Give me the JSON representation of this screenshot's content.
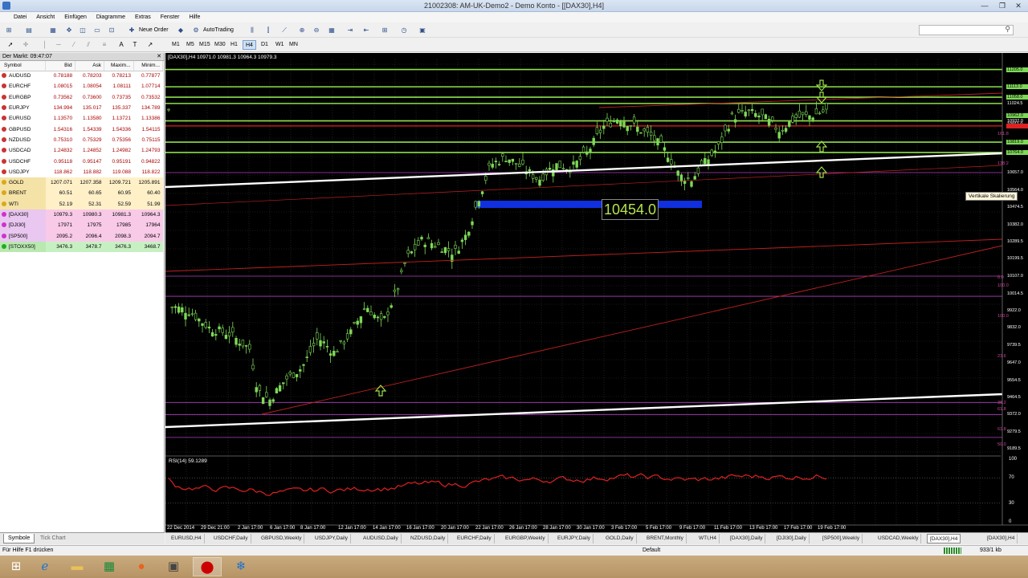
{
  "window": {
    "title": "21002308: AM-UK-Demo2 - Demo Konto - [[DAX30],H4]",
    "minimize": "—",
    "maximize": "❐",
    "close": "✕"
  },
  "menu": [
    "Datei",
    "Ansicht",
    "Einfügen",
    "Diagramme",
    "Extras",
    "Fenster",
    "Hilfe"
  ],
  "toolbar": {
    "new_order": "Neue Order",
    "autotrading": "AutoTrading",
    "timeframes": [
      "M1",
      "M5",
      "M15",
      "M30",
      "H1",
      "H4",
      "D1",
      "W1",
      "MN"
    ]
  },
  "market_watch": {
    "header": "Der Markt: 09:47:07",
    "columns": [
      "Symbol",
      "Bid",
      "Ask",
      "Maxim...",
      "Minim..."
    ],
    "rows": [
      {
        "symbol": "AUDUSD",
        "bid": "0.78188",
        "ask": "0.78203",
        "max": "0.78213",
        "min": "0.77877",
        "style": "fx"
      },
      {
        "symbol": "EURCHF",
        "bid": "1.08015",
        "ask": "1.08054",
        "max": "1.08111",
        "min": "1.07714",
        "style": "fx"
      },
      {
        "symbol": "EURGBP",
        "bid": "0.73562",
        "ask": "0.73600",
        "max": "0.73735",
        "min": "0.73532",
        "style": "fx"
      },
      {
        "symbol": "EURJPY",
        "bid": "134.994",
        "ask": "135.017",
        "max": "135.337",
        "min": "134.789",
        "style": "fx"
      },
      {
        "symbol": "EURUSD",
        "bid": "1.13570",
        "ask": "1.13580",
        "max": "1.13721",
        "min": "1.13386",
        "style": "fx"
      },
      {
        "symbol": "GBPUSD",
        "bid": "1.54316",
        "ask": "1.54339",
        "max": "1.54336",
        "min": "1.54115",
        "style": "fx"
      },
      {
        "symbol": "NZDUSD",
        "bid": "0.75310",
        "ask": "0.75329",
        "max": "0.75356",
        "min": "0.75115",
        "style": "fx"
      },
      {
        "symbol": "USDCAD",
        "bid": "1.24832",
        "ask": "1.24852",
        "max": "1.24982",
        "min": "1.24793",
        "style": "fx"
      },
      {
        "symbol": "USDCHF",
        "bid": "0.95118",
        "ask": "0.95147",
        "max": "0.95191",
        "min": "0.94822",
        "style": "fx"
      },
      {
        "symbol": "USDJPY",
        "bid": "118.862",
        "ask": "118.882",
        "max": "119.088",
        "min": "118.822",
        "style": "fx"
      },
      {
        "symbol": "GOLD",
        "bid": "1207.071",
        "ask": "1207.358",
        "max": "1209.721",
        "min": "1205.891",
        "style": "gold"
      },
      {
        "symbol": "BRENT",
        "bid": "60.51",
        "ask": "60.65",
        "max": "60.95",
        "min": "60.40",
        "style": "gold"
      },
      {
        "symbol": "WTI",
        "bid": "52.19",
        "ask": "52.31",
        "max": "52.59",
        "min": "51.99",
        "style": "gold"
      },
      {
        "symbol": "[DAX30]",
        "bid": "10979.3",
        "ask": "10980.3",
        "max": "10981.3",
        "min": "10964.3",
        "style": "pink"
      },
      {
        "symbol": "[DJI30]",
        "bid": "17971",
        "ask": "17975",
        "max": "17985",
        "min": "17964",
        "style": "pink"
      },
      {
        "symbol": "[SP500]",
        "bid": "2095.2",
        "ask": "2096.4",
        "max": "2098.3",
        "min": "2094.7",
        "style": "pink"
      },
      {
        "symbol": "[STOXX50]",
        "bid": "3476.3",
        "ask": "3478.7",
        "max": "3476.3",
        "min": "3468.7",
        "style": "green"
      }
    ],
    "tabs": [
      "Symbole",
      "Tick Chart"
    ]
  },
  "chart": {
    "title": "[DAX30],H4  10971.0 10981.3 10964.3 10979.3",
    "big_price": "10454.0",
    "tooltip": "Vertikale Skalierung",
    "rsi_title": "RSI(14) 59.1289",
    "price_axis": [
      "11205.0",
      "11113.0",
      "11058.0",
      "11024.5",
      "10962.0",
      "10932.0",
      "10911.0",
      "10819.0",
      "10764.0",
      "10657.0",
      "10564.0",
      "10474.5",
      "10382.0",
      "10289.5",
      "10199.5",
      "10107.0",
      "10014.5",
      "9922.0",
      "9832.0",
      "9739.5",
      "9647.0",
      "9554.5",
      "9464.5",
      "9372.0",
      "9279.5",
      "9189.5"
    ],
    "right_labels": [
      "161.8",
      "138.2",
      "0.0",
      "100.0",
      "100.0",
      "23.6",
      "38.2",
      "61.8",
      "61.8",
      "50.0"
    ],
    "rsi_axis": [
      "100",
      "70",
      "30",
      "0"
    ],
    "time_axis": [
      "22 Dec 2014",
      "29 Dec 21:00",
      "2 Jan 17:00",
      "6 Jan 17:00",
      "8 Jan 17:00",
      "12 Jan 17:00",
      "14 Jan 17:00",
      "16 Jan 17:00",
      "20 Jan 17:00",
      "22 Jan 17:00",
      "26 Jan 17:00",
      "28 Jan 17:00",
      "30 Jan 17:00",
      "3 Feb 17:00",
      "5 Feb 17:00",
      "9 Feb 17:00",
      "11 Feb 17:00",
      "13 Feb 17:00",
      "17 Feb 17:00",
      "19 Feb 17:00"
    ]
  },
  "chart_tabs": [
    "EURUSD,H4",
    "USDCHF,Daily",
    "GBPUSD,Weekly",
    "USDJPY,Daily",
    "AUDUSD,Daily",
    "NZDUSD,Daily",
    "EURCHF,Daily",
    "EURGBP,Weekly",
    "EURJPY,Daily",
    "GOLD,Daily",
    "BRENT,Monthly",
    "WTI,H4",
    "[DAX30],Daily",
    "[DJI30],Daily",
    "[SP500],Weekly",
    "USDCAD,Weekly",
    "[DAX30],H4",
    "[DAX30],H4"
  ],
  "status": {
    "help": "Für Hilfe F1 drücken",
    "profile": "Default",
    "traffic": "933/1 kb"
  },
  "colors": {
    "chart_bg": "#000000",
    "candle": "#7ed957",
    "level_green": "#8ee04a",
    "trend_white": "#ffffff",
    "trend_red": "#c02020",
    "rsi": "#e02020",
    "blue_box": "#1030e0"
  }
}
